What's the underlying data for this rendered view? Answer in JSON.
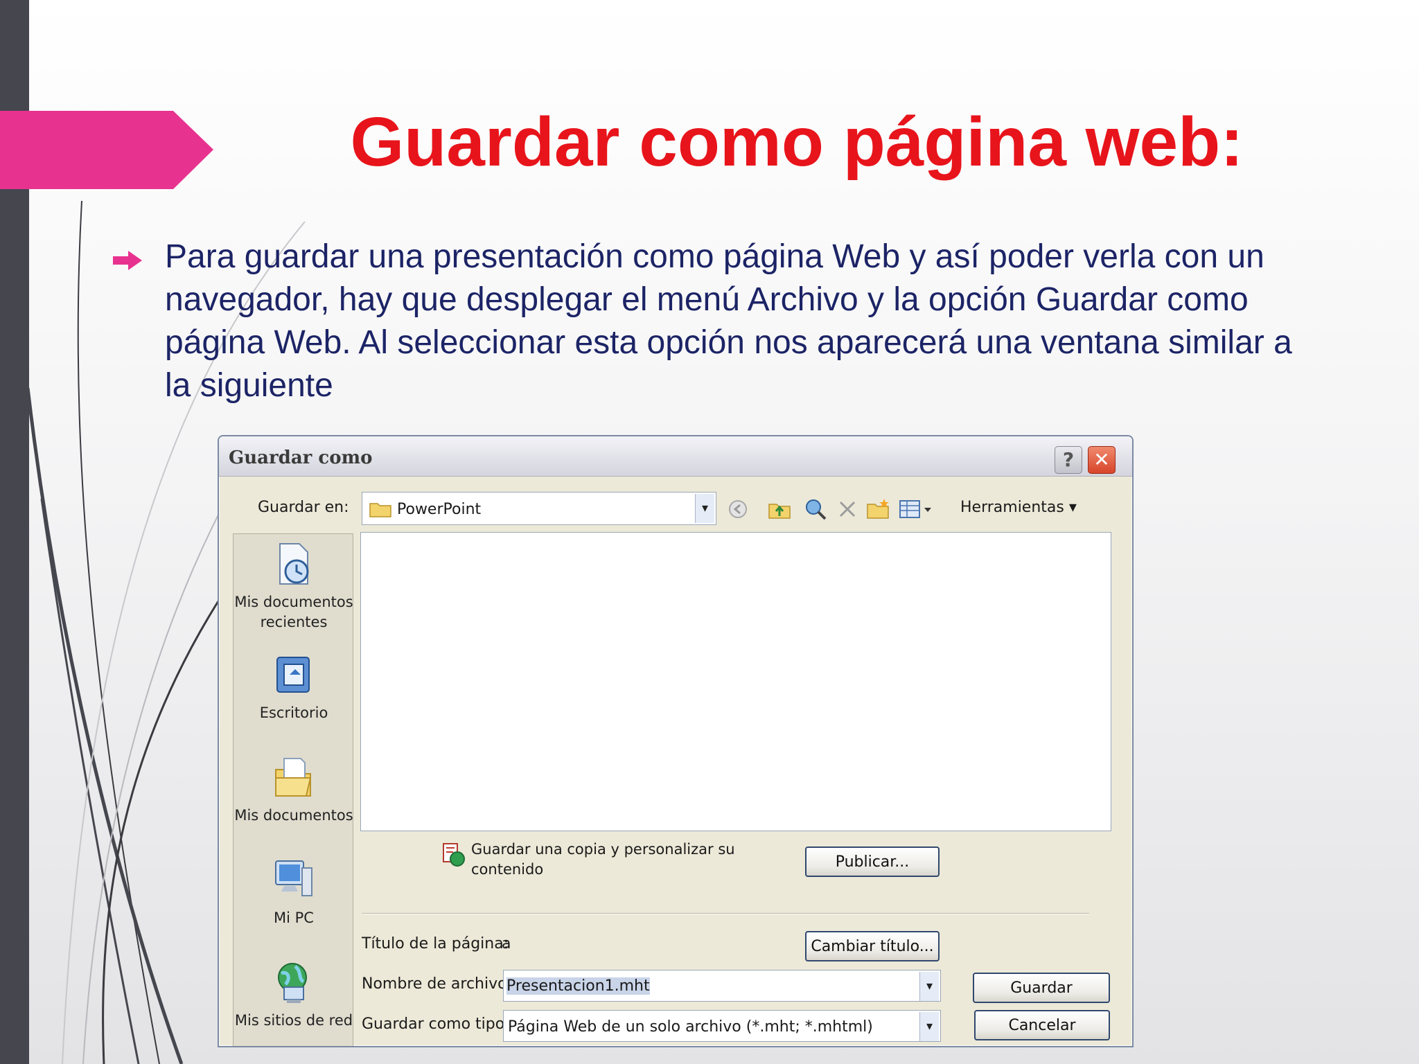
{
  "slide": {
    "title": "Guardar como página web:",
    "body": "Para guardar una presentación como página Web y así poder verla con un navegador, hay que desplegar el menú Archivo y la opción Guardar como página Web. Al seleccionar esta opción nos aparecerá una ventana similar a la siguiente",
    "accent_color": "#e8328f",
    "title_color": "#e8141b",
    "text_color": "#1c2466"
  },
  "dialog": {
    "title": "Guardar como",
    "help_glyph": "?",
    "close_glyph": "✕",
    "save_in_label": "Guardar en:",
    "location": "PowerPoint",
    "combo_arrow": "▾",
    "tools_label": "Herramientas ▾",
    "places": [
      {
        "label": "Mis documentos recientes",
        "icon": "recent-documents-icon"
      },
      {
        "label": "Escritorio",
        "icon": "desktop-icon"
      },
      {
        "label": "Mis documentos",
        "icon": "my-documents-icon"
      },
      {
        "label": "Mi PC",
        "icon": "my-computer-icon"
      },
      {
        "label": "Mis sitios de red",
        "icon": "network-places-icon"
      }
    ],
    "copy_text": "Guardar una copia y personalizar su contenido",
    "publish_button": "Publicar...",
    "page_title_label": "Título de la página:",
    "page_title_value": "a",
    "change_title_button": "Cambiar título...",
    "filename_label": "Nombre de archivo:",
    "filename_value": "Presentacion1.mht",
    "filetype_label": "Guardar como tipo:",
    "filetype_value": "Página Web de un solo archivo (*.mht; *.mhtml)",
    "save_button": "Guardar",
    "cancel_button": "Cancelar"
  }
}
